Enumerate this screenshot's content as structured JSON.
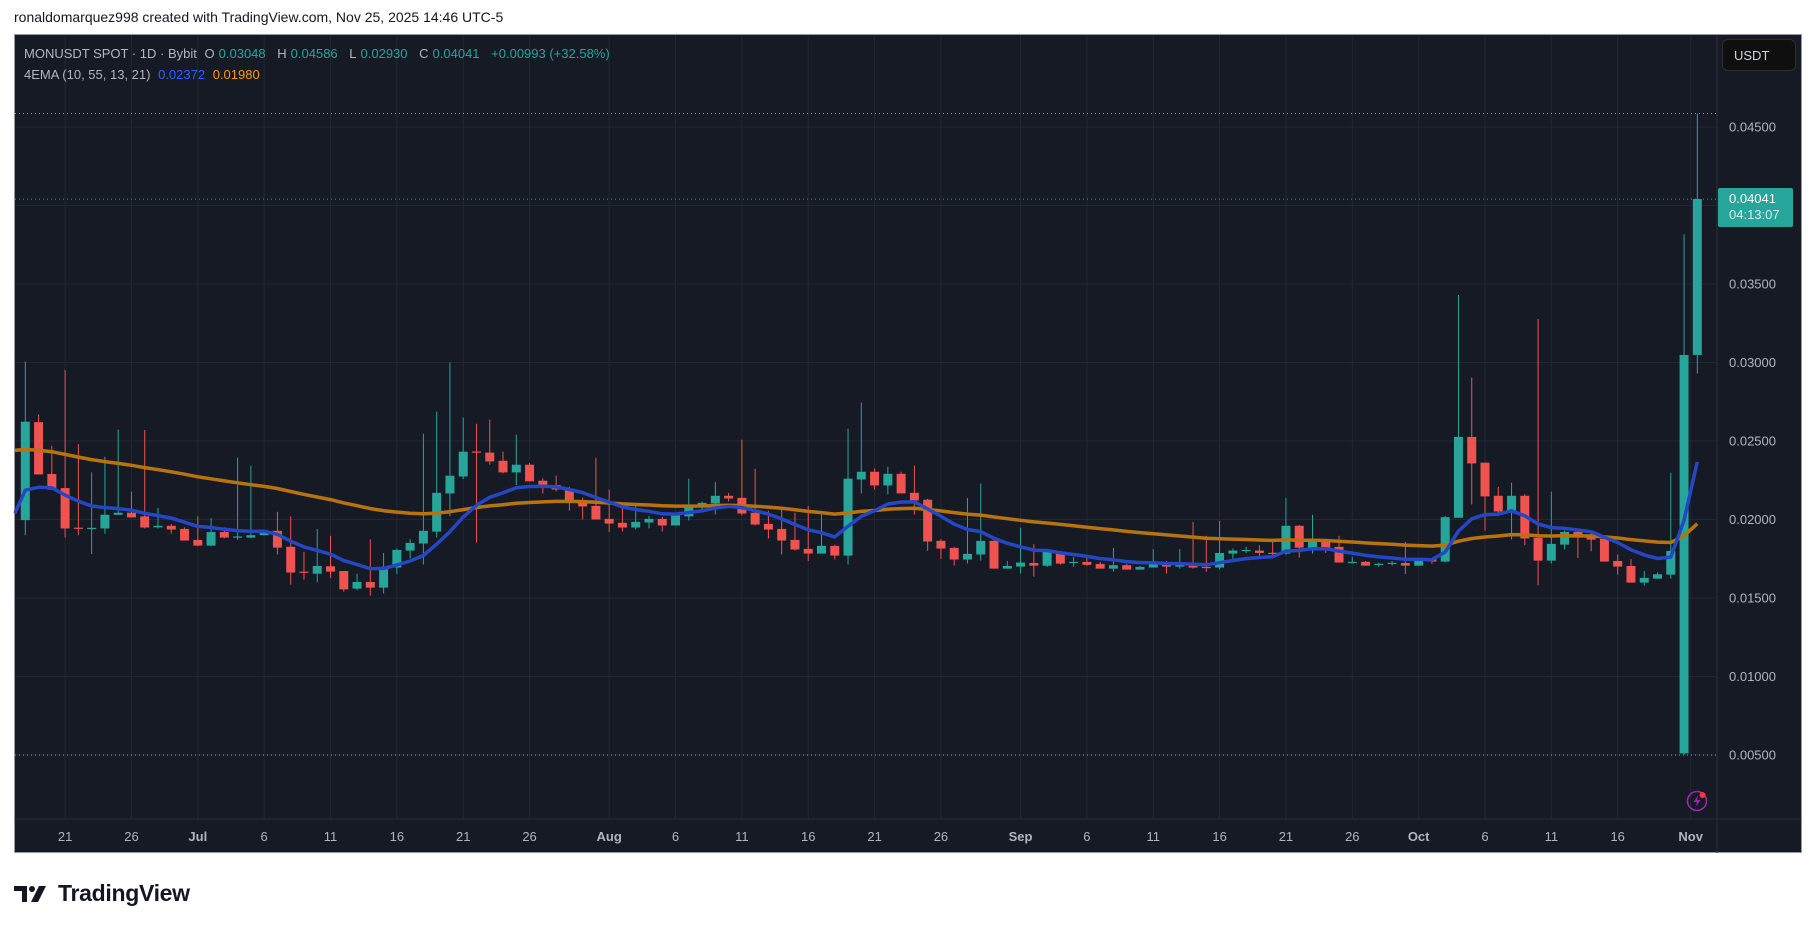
{
  "credit": "ronaldomarquez998 created with TradingView.com, Nov 25, 2025 14:46 UTC-5",
  "legend": {
    "symbol": "MONUSDT SPOT · 1D · Bybit",
    "o_label": "O",
    "o": "0.03048",
    "h_label": "H",
    "h": "0.04586",
    "l_label": "L",
    "l": "0.02930",
    "c_label": "C",
    "c": "0.04041",
    "change": "+0.00993 (+32.58%)",
    "indicator": "4EMA (10, 55, 13, 21)",
    "ema_fast": "0.02372",
    "ema_slow": "0.01980"
  },
  "currency_button": "USDT",
  "price_label": {
    "price": "0.04041",
    "countdown": "04:13:07"
  },
  "logo_text": "TradingView",
  "colors": {
    "up": "#26a69a",
    "down": "#ef5350",
    "ema_fast": "#2447c6",
    "ema_slow": "#b8730f",
    "background": "#161a25",
    "grid": "#232733"
  },
  "chart_data": {
    "type": "candlestick",
    "symbol": "MONUSDT",
    "y_ticks": [
      "0.00500",
      "0.01000",
      "0.01500",
      "0.02000",
      "0.02500",
      "0.03000",
      "0.03500",
      "0.04000",
      "0.04500"
    ],
    "ylim": [
      0.0008,
      0.0495
    ],
    "x_labels": [
      {
        "label": "21",
        "bar": 3
      },
      {
        "label": "26",
        "bar": 8
      },
      {
        "label": "Jul",
        "bar": 13,
        "bold": true
      },
      {
        "label": "6",
        "bar": 18
      },
      {
        "label": "11",
        "bar": 23
      },
      {
        "label": "16",
        "bar": 28
      },
      {
        "label": "21",
        "bar": 33
      },
      {
        "label": "26",
        "bar": 38
      },
      {
        "label": "Aug",
        "bar": 44,
        "bold": true
      },
      {
        "label": "6",
        "bar": 49
      },
      {
        "label": "11",
        "bar": 54
      },
      {
        "label": "16",
        "bar": 59
      },
      {
        "label": "21",
        "bar": 64
      },
      {
        "label": "26",
        "bar": 69
      },
      {
        "label": "Sep",
        "bar": 75,
        "bold": true
      },
      {
        "label": "6",
        "bar": 80
      },
      {
        "label": "11",
        "bar": 85
      },
      {
        "label": "16",
        "bar": 90
      },
      {
        "label": "21",
        "bar": 95
      },
      {
        "label": "26",
        "bar": 100
      },
      {
        "label": "Oct",
        "bar": 105,
        "bold": true
      },
      {
        "label": "6",
        "bar": 110
      },
      {
        "label": "11",
        "bar": 115
      },
      {
        "label": "16",
        "bar": 120
      },
      {
        "label": "Nov",
        "bar": 125.5,
        "bold": true
      }
    ],
    "ema": {
      "fast_period": 10,
      "slow_period": 55,
      "fast_seed": 0.0209,
      "slow_seed": 0.0244
    },
    "reference_lines": {
      "high": 0.04586,
      "close": 0.04041,
      "low": 0.005
    },
    "ohlc": [
      [
        0.01996,
        0.03006,
        0.019,
        0.02623
      ],
      [
        0.0262,
        0.0267,
        0.02287,
        0.02287
      ],
      [
        0.0229,
        0.0247,
        0.0219,
        0.0219
      ],
      [
        0.022,
        0.02953,
        0.01885,
        0.01943
      ],
      [
        0.01948,
        0.0248,
        0.019,
        0.01943
      ],
      [
        0.01945,
        0.023,
        0.0178,
        0.01947
      ],
      [
        0.01943,
        0.024,
        0.0191,
        0.0203
      ],
      [
        0.0203,
        0.02572,
        0.0203,
        0.02043
      ],
      [
        0.02043,
        0.02177,
        0.02013,
        0.02013
      ],
      [
        0.0202,
        0.0257,
        0.01943,
        0.01949
      ],
      [
        0.0195,
        0.02074,
        0.01943,
        0.0196
      ],
      [
        0.0196,
        0.0197,
        0.0191,
        0.01936
      ],
      [
        0.0194,
        0.0195,
        0.01866,
        0.01866
      ],
      [
        0.0187,
        0.0202,
        0.0183,
        0.01834
      ],
      [
        0.01834,
        0.0201,
        0.0183,
        0.0192
      ],
      [
        0.0192,
        0.0195,
        0.0188,
        0.01885
      ],
      [
        0.0189,
        0.02394,
        0.0187,
        0.01892
      ],
      [
        0.01885,
        0.02343,
        0.0188,
        0.019
      ],
      [
        0.019,
        0.0193,
        0.019,
        0.01928
      ],
      [
        0.01928,
        0.02049,
        0.01777,
        0.01821
      ],
      [
        0.01826,
        0.0202,
        0.01585,
        0.01662
      ],
      [
        0.01668,
        0.01794,
        0.01617,
        0.01664
      ],
      [
        0.01655,
        0.0194,
        0.016,
        0.01704
      ],
      [
        0.01702,
        0.01896,
        0.01628,
        0.01668
      ],
      [
        0.01672,
        0.01672,
        0.0154,
        0.01555
      ],
      [
        0.0156,
        0.01655,
        0.0155,
        0.01602
      ],
      [
        0.01602,
        0.01874,
        0.01515,
        0.01566
      ],
      [
        0.01566,
        0.01787,
        0.01529,
        0.01698
      ],
      [
        0.01694,
        0.01815,
        0.01652,
        0.01806
      ],
      [
        0.01802,
        0.01874,
        0.01753,
        0.01851
      ],
      [
        0.01847,
        0.02547,
        0.01713,
        0.01928
      ],
      [
        0.01923,
        0.02687,
        0.01885,
        0.0217
      ],
      [
        0.02166,
        0.03,
        0.02021,
        0.02279
      ],
      [
        0.02274,
        0.02649,
        0.02257,
        0.02432
      ],
      [
        0.02433,
        0.0261,
        0.01853,
        0.02431
      ],
      [
        0.02426,
        0.02636,
        0.02349,
        0.0237
      ],
      [
        0.02374,
        0.02432,
        0.02294,
        0.023
      ],
      [
        0.023,
        0.0254,
        0.02219,
        0.02349
      ],
      [
        0.02349,
        0.0236,
        0.02243,
        0.02243
      ],
      [
        0.02247,
        0.02262,
        0.02166,
        0.02217
      ],
      [
        0.0222,
        0.02279,
        0.0218,
        0.02191
      ],
      [
        0.02196,
        0.02208,
        0.02057,
        0.02115
      ],
      [
        0.0212,
        0.02138,
        0.02,
        0.02083
      ],
      [
        0.02087,
        0.02394,
        0.02,
        0.02
      ],
      [
        0.02004,
        0.02191,
        0.0192,
        0.01974
      ],
      [
        0.01979,
        0.02102,
        0.01923,
        0.01949
      ],
      [
        0.01949,
        0.02087,
        0.01936,
        0.01985
      ],
      [
        0.01981,
        0.02023,
        0.01943,
        0.02004
      ],
      [
        0.02004,
        0.02017,
        0.01923,
        0.01962
      ],
      [
        0.01962,
        0.02034,
        0.01962,
        0.02026
      ],
      [
        0.0202,
        0.0226,
        0.01994,
        0.02091
      ],
      [
        0.02091,
        0.02115,
        0.02064,
        0.02106
      ],
      [
        0.02102,
        0.0224,
        0.02032,
        0.02151
      ],
      [
        0.02151,
        0.0217,
        0.02115,
        0.02134
      ],
      [
        0.02138,
        0.02509,
        0.02026,
        0.02038
      ],
      [
        0.02043,
        0.02323,
        0.01962,
        0.01968
      ],
      [
        0.01972,
        0.02055,
        0.01879,
        0.01936
      ],
      [
        0.0194,
        0.02072,
        0.01777,
        0.01866
      ],
      [
        0.0187,
        0.02043,
        0.01802,
        0.01809
      ],
      [
        0.01813,
        0.02087,
        0.01736,
        0.01783
      ],
      [
        0.01783,
        0.02032,
        0.01783,
        0.01832
      ],
      [
        0.01832,
        0.0184,
        0.01745,
        0.0177
      ],
      [
        0.0177,
        0.02579,
        0.01713,
        0.0226
      ],
      [
        0.02255,
        0.02745,
        0.02166,
        0.02304
      ],
      [
        0.02304,
        0.02325,
        0.02191,
        0.02217
      ],
      [
        0.02217,
        0.02336,
        0.0216,
        0.02291
      ],
      [
        0.02291,
        0.02304,
        0.02166,
        0.02166
      ],
      [
        0.0217,
        0.02343,
        0.02032,
        0.02121
      ],
      [
        0.02126,
        0.02132,
        0.018,
        0.0186
      ],
      [
        0.01864,
        0.01875,
        0.01749,
        0.01815
      ],
      [
        0.01819,
        0.01826,
        0.01707,
        0.01745
      ],
      [
        0.01745,
        0.02138,
        0.0172,
        0.01781
      ],
      [
        0.01777,
        0.02228,
        0.01738,
        0.01864
      ],
      [
        0.01864,
        0.01868,
        0.01687,
        0.01687
      ],
      [
        0.01687,
        0.01736,
        0.01687,
        0.01704
      ],
      [
        0.017,
        0.01947,
        0.01655,
        0.01726
      ],
      [
        0.01723,
        0.01843,
        0.01636,
        0.01706
      ],
      [
        0.01706,
        0.018,
        0.01698,
        0.01794
      ],
      [
        0.01794,
        0.018,
        0.01713,
        0.01719
      ],
      [
        0.0173,
        0.01762,
        0.01698,
        0.0173
      ],
      [
        0.0173,
        0.01755,
        0.01706,
        0.01711
      ],
      [
        0.01717,
        0.0173,
        0.01687,
        0.01687
      ],
      [
        0.01687,
        0.01819,
        0.01668,
        0.01709
      ],
      [
        0.01709,
        0.01717,
        0.01681,
        0.01681
      ],
      [
        0.01681,
        0.01704,
        0.01681,
        0.01698
      ],
      [
        0.01694,
        0.01811,
        0.01694,
        0.01717
      ],
      [
        0.01717,
        0.01736,
        0.01655,
        0.017
      ],
      [
        0.017,
        0.01811,
        0.01687,
        0.01717
      ],
      [
        0.01717,
        0.01985,
        0.01687,
        0.01694
      ],
      [
        0.01698,
        0.01896,
        0.01668,
        0.01696
      ],
      [
        0.01694,
        0.01991,
        0.01683,
        0.01787
      ],
      [
        0.01783,
        0.01815,
        0.0175,
        0.01802
      ],
      [
        0.01805,
        0.01826,
        0.01787,
        0.01806
      ],
      [
        0.01802,
        0.01836,
        0.0175,
        0.01787
      ],
      [
        0.01788,
        0.01857,
        0.01762,
        0.01787
      ],
      [
        0.01783,
        0.02138,
        0.01777,
        0.0196
      ],
      [
        0.0196,
        0.01966,
        0.01757,
        0.01821
      ],
      [
        0.01821,
        0.0203,
        0.01783,
        0.01862
      ],
      [
        0.01862,
        0.01862,
        0.01787,
        0.01821
      ],
      [
        0.01826,
        0.01896,
        0.01726,
        0.01726
      ],
      [
        0.0173,
        0.01762,
        0.01726,
        0.0173
      ],
      [
        0.0173,
        0.01736,
        0.01706,
        0.01706
      ],
      [
        0.01717,
        0.01726,
        0.01698,
        0.01718
      ],
      [
        0.01723,
        0.01736,
        0.01706,
        0.01724
      ],
      [
        0.01723,
        0.01857,
        0.01653,
        0.01706
      ],
      [
        0.01706,
        0.01751,
        0.01706,
        0.01747
      ],
      [
        0.01747,
        0.01755,
        0.01717,
        0.01732
      ],
      [
        0.01732,
        0.02023,
        0.01726,
        0.02015
      ],
      [
        0.02011,
        0.0343,
        0.02011,
        0.02526
      ],
      [
        0.02526,
        0.02904,
        0.02096,
        0.02357
      ],
      [
        0.02362,
        0.02362,
        0.01928,
        0.02147
      ],
      [
        0.02151,
        0.02208,
        0.02023,
        0.02051
      ],
      [
        0.02051,
        0.02234,
        0.01872,
        0.02151
      ],
      [
        0.02151,
        0.02162,
        0.01836,
        0.01879
      ],
      [
        0.01883,
        0.03277,
        0.01581,
        0.01738
      ],
      [
        0.01738,
        0.02177,
        0.01719,
        0.01845
      ],
      [
        0.0184,
        0.01928,
        0.01809,
        0.01921
      ],
      [
        0.01921,
        0.01928,
        0.01755,
        0.01885
      ],
      [
        0.01889,
        0.01928,
        0.01798,
        0.01872
      ],
      [
        0.01877,
        0.01877,
        0.01732,
        0.01732
      ],
      [
        0.01736,
        0.01777,
        0.01649,
        0.017
      ],
      [
        0.01704,
        0.01749,
        0.01598,
        0.01598
      ],
      [
        0.01598,
        0.01672,
        0.01579,
        0.01628
      ],
      [
        0.01623,
        0.01662,
        0.01623,
        0.01651
      ],
      [
        0.01649,
        0.02298,
        0.01623,
        0.018
      ],
      [
        0.0051,
        0.03816,
        0.005,
        0.03048
      ],
      [
        0.03048,
        0.04586,
        0.0293,
        0.04041
      ]
    ]
  }
}
